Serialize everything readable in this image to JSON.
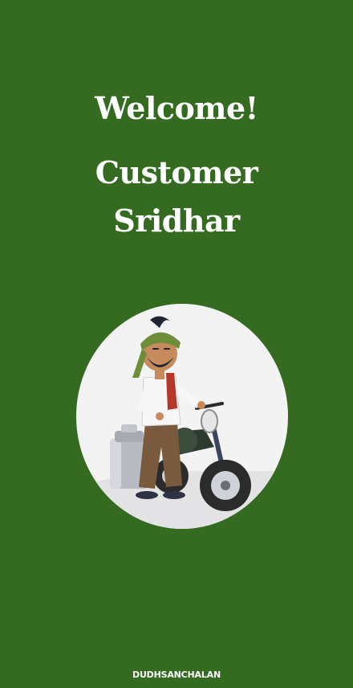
{
  "screen": {
    "welcome_text": "Welcome!",
    "role_text": "Customer",
    "name_text": "Sridhar",
    "brand_text": "DUDHSANCHALAN"
  },
  "illustration": {
    "icon": "milkman-with-motorcycle-illustration"
  },
  "colors": {
    "background": "#346b21",
    "circle": "#f3f3f4",
    "text": "#ffffff"
  }
}
